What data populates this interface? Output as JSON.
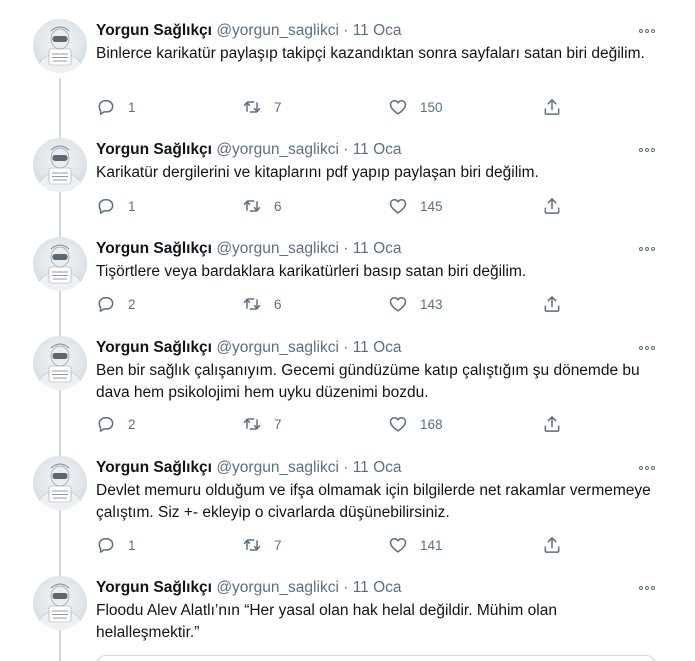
{
  "tweets": [
    {
      "name": "Yorgun Sağlıkçı",
      "handle": "@yorgun_saglikci",
      "dot": "·",
      "time": "11 Oca",
      "text": "Binlerce karikatür paylaşıp takipçi kazandıktan sonra sayfaları satan biri değilim.",
      "replies": "1",
      "retweets": "7",
      "likes": "150"
    },
    {
      "name": "Yorgun Sağlıkçı",
      "handle": "@yorgun_saglikci",
      "dot": "·",
      "time": "11 Oca",
      "text": "Karikatür dergilerini ve kitaplarını pdf yapıp paylaşan biri değilim.",
      "replies": "1",
      "retweets": "6",
      "likes": "145"
    },
    {
      "name": "Yorgun Sağlıkçı",
      "handle": "@yorgun_saglikci",
      "dot": "·",
      "time": "11 Oca",
      "text": "Tişörtlere veya bardaklara karikatürleri basıp satan biri değilim.",
      "replies": "2",
      "retweets": "6",
      "likes": "143"
    },
    {
      "name": "Yorgun Sağlıkçı",
      "handle": "@yorgun_saglikci",
      "dot": "·",
      "time": "11 Oca",
      "text": "Ben bir sağlık çalışanıyım. Gecemi gündüzüme katıp çalıştığım şu dönemde bu dava hem psikolojimi hem uyku düzenimi bozdu.",
      "replies": "2",
      "retweets": "7",
      "likes": "168"
    },
    {
      "name": "Yorgun Sağlıkçı",
      "handle": "@yorgun_saglikci",
      "dot": "·",
      "time": "11 Oca",
      "text": "Devlet memuru olduğum ve ifşa olmamak için bilgilerde net rakamlar vermemeye çalıştım. Siz +- ekleyip o civarlarda düşünebilirsiniz.",
      "replies": "1",
      "retweets": "7",
      "likes": "141"
    },
    {
      "name": "Yorgun Sağlıkçı",
      "handle": "@yorgun_saglikci",
      "dot": "·",
      "time": "11 Oca",
      "text": "Floodu Alev Alatlı’nın “Her yasal olan hak helal değildir. Mühim olan helalleşmektir.”"
    }
  ],
  "icons": {
    "reply": "reply-icon",
    "retweet": "retweet-icon",
    "like": "heart-icon",
    "share": "share-icon",
    "more": "more-icon"
  },
  "colors": {
    "text": "#0f1419",
    "secondary": "#5b7083",
    "thread_line": "#cfd9de"
  }
}
